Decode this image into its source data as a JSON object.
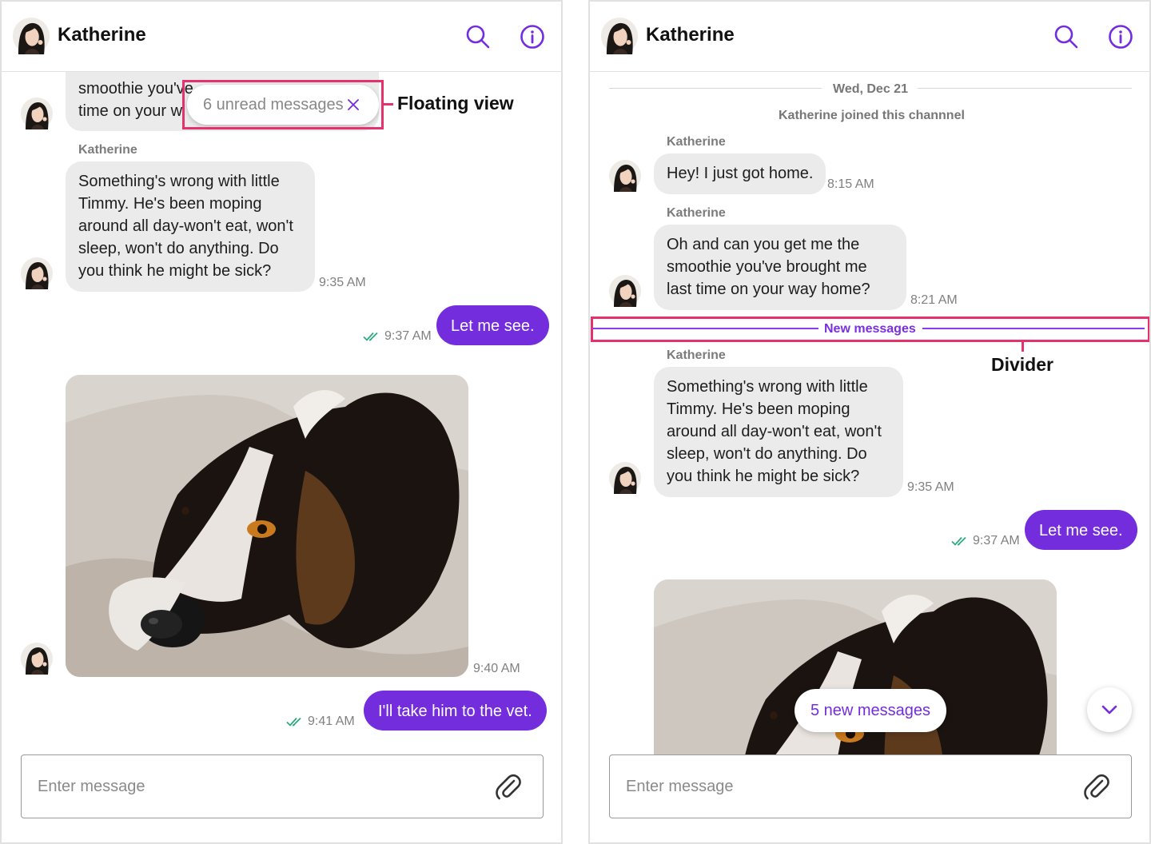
{
  "colors": {
    "accent": "#742ddd",
    "annotation": "#e4326c",
    "incoming_bubble": "#ebebeb",
    "read_tick": "#2eaa7e"
  },
  "left": {
    "header": {
      "title": "Katherine",
      "search_icon": "search-icon",
      "info_icon": "info-icon"
    },
    "partial_message": {
      "lines": [
        "smoothie you've",
        "time on your w"
      ]
    },
    "floating_view": {
      "text": "6 unread messages",
      "close_icon": "close-icon"
    },
    "callout": "Floating view",
    "messages": [
      {
        "sender": "Katherine",
        "text": "Something's wrong with little Timmy. He's been moping around all day-won't eat, won't sleep, won't do anything. Do you think he might be sick?",
        "time": "9:35 AM"
      },
      {
        "text": "Let me see.",
        "time": "9:37 AM"
      },
      {
        "image": "dog-photo",
        "time": "9:40 AM"
      },
      {
        "text": "I'll take him to the vet.",
        "time": "9:41 AM"
      }
    ],
    "composer": {
      "placeholder": "Enter message",
      "attach_icon": "paperclip-icon"
    }
  },
  "right": {
    "header": {
      "title": "Katherine",
      "search_icon": "search-icon",
      "info_icon": "info-icon"
    },
    "date_separator": "Wed, Dec 21",
    "system_message": "Katherine joined this channnel",
    "messages": [
      {
        "sender": "Katherine",
        "text": "Hey! I just got home.",
        "time": "8:15 AM"
      },
      {
        "sender": "Katherine",
        "text": "Oh and can you get me the smoothie you've brought me last time on your way home?",
        "time": "8:21 AM"
      },
      {
        "sender": "Katherine",
        "text": "Something's wrong with little Timmy. He's been moping around all day-won't eat, won't sleep, won't do anything. Do you think he might be sick?",
        "time": "9:35 AM"
      },
      {
        "text": "Let me see.",
        "time": "9:37 AM"
      },
      {
        "image": "dog-photo"
      }
    ],
    "divider": "New messages",
    "callout": "Divider",
    "new_messages_button": "5 new messages",
    "scroll_icon": "chevron-down-icon",
    "composer": {
      "placeholder": "Enter message",
      "attach_icon": "paperclip-icon"
    }
  }
}
